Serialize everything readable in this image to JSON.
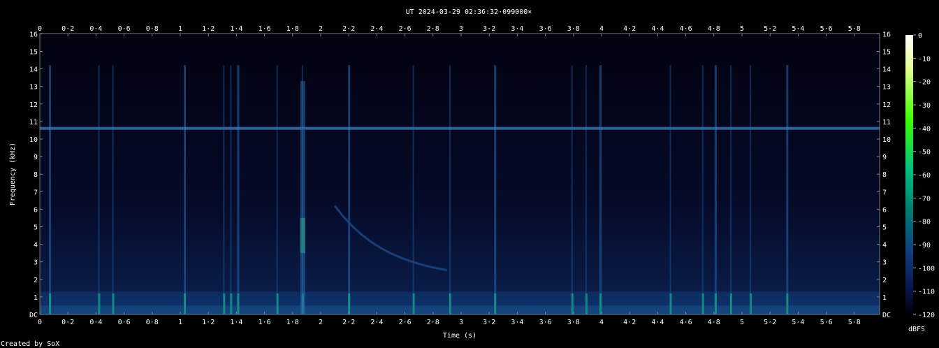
{
  "chart_data": {
    "type": "heatmap",
    "title": "UT 2024-03-29 02:36:32·099000×",
    "xlabel": "Time (s)",
    "ylabel": "Frequency (kHz)",
    "xlim": [
      0,
      5.98
    ],
    "ylim": [
      0,
      16
    ],
    "x_ticks": [
      "0",
      "0·2",
      "0·4",
      "0·6",
      "0·8",
      "1",
      "1·2",
      "1·4",
      "1·6",
      "1·8",
      "2",
      "2·2",
      "2·4",
      "2·6",
      "2·8",
      "3",
      "3·2",
      "3·4",
      "3·6",
      "3·8",
      "4",
      "4·2",
      "4·4",
      "4·6",
      "4·8",
      "5",
      "5·2",
      "5·4",
      "5·6",
      "5·8"
    ],
    "y_ticks": [
      "DC",
      "1",
      "2",
      "3",
      "4",
      "5",
      "6",
      "7",
      "8",
      "9",
      "10",
      "11",
      "12",
      "13",
      "14",
      "15",
      "16"
    ],
    "colorbar": {
      "label": "dBFS",
      "range": [
        -120,
        0
      ],
      "ticks": [
        "0",
        "-10",
        "-20",
        "-30",
        "-40",
        "-50",
        "-60",
        "-70",
        "-80",
        "-90",
        "-100",
        "-110",
        "-120"
      ],
      "colors": [
        "#ffffff",
        "#e0ff80",
        "#40ff00",
        "#00c070",
        "#008060",
        "#104080",
        "#0a1a50",
        "#000000"
      ]
    },
    "features": {
      "hum_band_khz": 10.6,
      "low_band_khz": [
        0,
        1.3
      ],
      "broadband_impulses_s": [
        0.07,
        0.42,
        0.52,
        1.03,
        1.31,
        1.36,
        1.41,
        1.69,
        1.87,
        2.2,
        2.66,
        2.92,
        3.24,
        3.79,
        3.89,
        3.99,
        4.49,
        4.72,
        4.81,
        4.92,
        5.06,
        5.32
      ]
    }
  },
  "footer": {
    "credit": "Created by SoX"
  }
}
